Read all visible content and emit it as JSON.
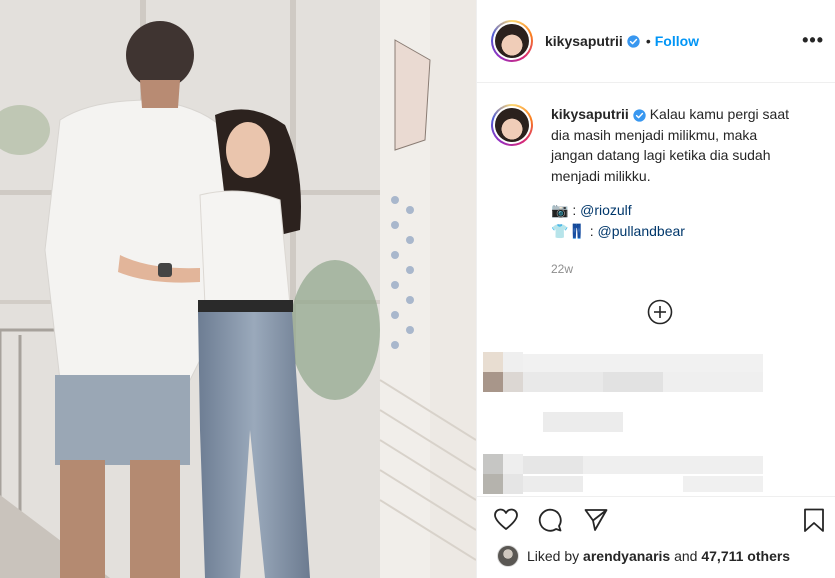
{
  "post": {
    "username": "kikysaputrii",
    "follow_label": "Follow",
    "separator": "•",
    "more_label": "•••",
    "caption": {
      "lines": [
        "Kalau kamu pergi saat",
        "dia masih menjadi milikmu, maka",
        "jangan datang lagi ketika dia sudah",
        "menjadi milikku."
      ],
      "credit_photo_prefix": "📷 : ",
      "credit_photo_mention": "@riozulf",
      "credit_outfit_prefix": "👕👖 : ",
      "credit_outfit_mention": "@pullandbear",
      "time_ago": "22w"
    },
    "likes": {
      "prefix": "Liked by ",
      "user": "arendyanaris",
      "middle": " and ",
      "count": "47,711 others"
    }
  },
  "icons": {
    "verified": "verified-badge-icon",
    "add_comment": "plus-circle-icon",
    "like": "heart-icon",
    "comment": "comment-icon",
    "share": "paper-plane-icon",
    "save": "bookmark-icon"
  },
  "colors": {
    "accent": "#0095f6",
    "mention": "#00376b",
    "muted": "#8e8e8e",
    "verified": "#3897f0"
  }
}
